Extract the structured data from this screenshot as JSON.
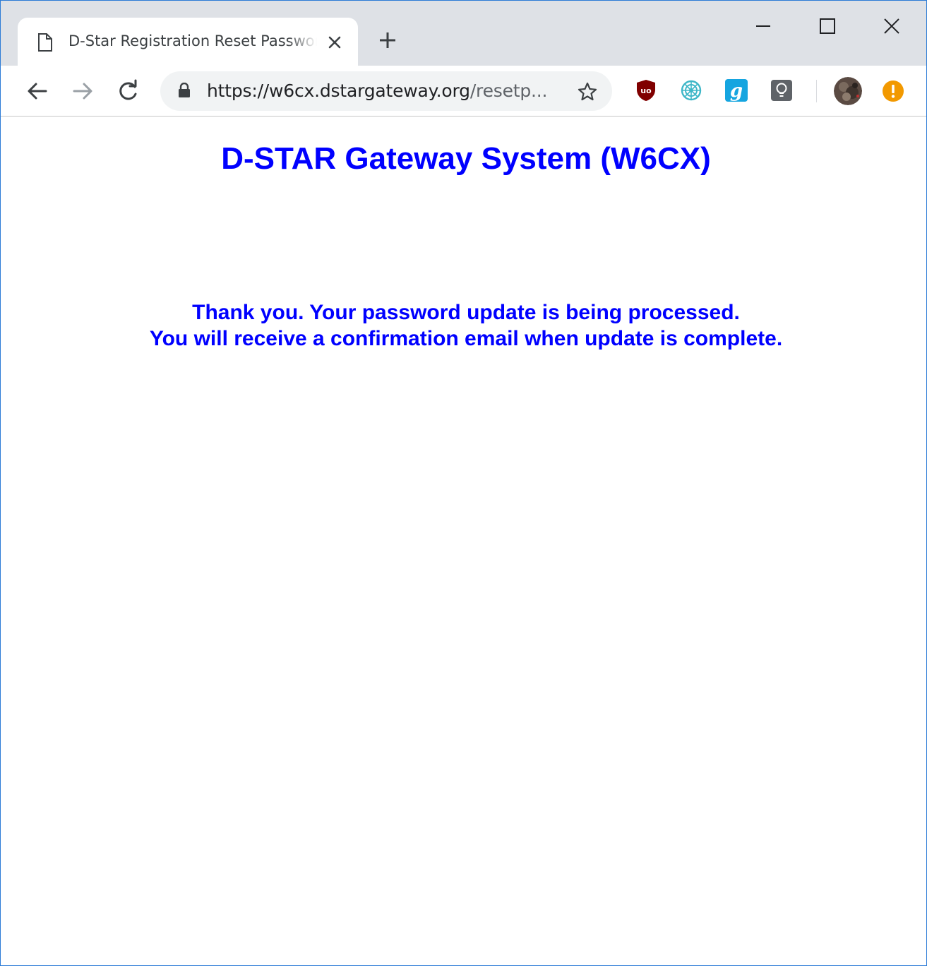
{
  "browser": {
    "tab": {
      "title": "D-Star Registration Reset Password",
      "icon": "page-icon"
    },
    "new_tab_icon": "plus-icon",
    "window_controls": [
      "minimize-icon",
      "maximize-icon",
      "close-icon"
    ],
    "toolbar": {
      "back_icon": "arrow-left-icon",
      "forward_icon": "arrow-right-icon",
      "reload_icon": "reload-icon",
      "address": {
        "scheme_host": "https://w6cx.dstargateway.org",
        "path": "/resetp...",
        "lock_icon": "lock-icon",
        "bookmark_icon": "star-icon"
      },
      "extensions": [
        "ublock-origin-icon",
        "web-extension-icon",
        "grammarly-icon",
        "lightbulb-icon"
      ],
      "profile_icon": "profile-avatar",
      "update_icon": "update-alert-icon"
    }
  },
  "page": {
    "heading": "D-STAR Gateway System (W6CX)",
    "message_lines": [
      "Thank you. Your password update is being processed.",
      "You will receive a confirmation email when update is complete."
    ],
    "text_color": "#0000ff"
  }
}
